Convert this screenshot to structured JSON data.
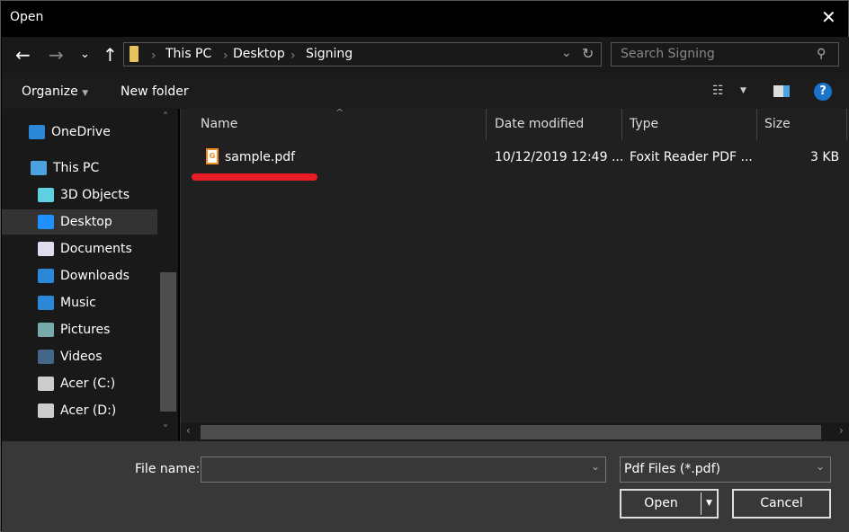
{
  "window": {
    "title": "Open"
  },
  "address": {
    "crumbs": [
      "This PC",
      "Desktop",
      "Signing"
    ]
  },
  "search": {
    "placeholder": "Search Signing"
  },
  "toolbar": {
    "organize": "Organize",
    "new_folder": "New folder"
  },
  "nav": {
    "items": [
      {
        "label": "OneDrive",
        "icon": "cloud-icon",
        "color": "#2b88d8"
      },
      {
        "label": "This PC",
        "icon": "computer-icon",
        "color": "#4aa3df"
      },
      {
        "label": "3D Objects",
        "icon": "cube-icon",
        "color": "#5fd0e0"
      },
      {
        "label": "Desktop",
        "icon": "desktop-icon",
        "color": "#1e90ff",
        "selected": true
      },
      {
        "label": "Documents",
        "icon": "document-icon",
        "color": "#dde"
      },
      {
        "label": "Downloads",
        "icon": "download-icon",
        "color": "#2b88d8"
      },
      {
        "label": "Music",
        "icon": "music-icon",
        "color": "#2b88d8"
      },
      {
        "label": "Pictures",
        "icon": "pictures-icon",
        "color": "#7aa"
      },
      {
        "label": "Videos",
        "icon": "videos-icon",
        "color": "#468"
      },
      {
        "label": "Acer (C:)",
        "icon": "drive-icon",
        "color": "#ccc"
      },
      {
        "label": "Acer (D:)",
        "icon": "drive-icon",
        "color": "#ccc"
      }
    ]
  },
  "columns": [
    "Name",
    "Date modified",
    "Type",
    "Size"
  ],
  "files": [
    {
      "name": "sample.pdf",
      "date": "10/12/2019 12:49 ...",
      "type": "Foxit Reader PDF ...",
      "size": "3 KB"
    }
  ],
  "annotation_color": "#e81c24",
  "bottom": {
    "file_name_label": "File name:",
    "file_name_value": "",
    "filter": "Pdf Files (*.pdf)",
    "open": "Open",
    "cancel": "Cancel"
  }
}
